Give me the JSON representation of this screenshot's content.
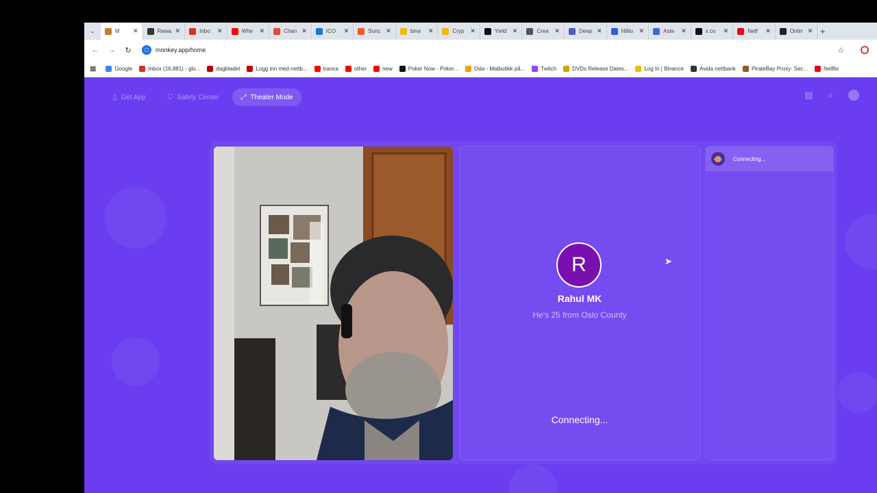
{
  "browser": {
    "tabs": [
      {
        "label": "M",
        "color": "#c97a2a",
        "active": true
      },
      {
        "label": "Rewa",
        "color": "#333333"
      },
      {
        "label": "Inbo",
        "color": "#d93025"
      },
      {
        "label": "Whe",
        "color": "#ff0000"
      },
      {
        "label": "Chan",
        "color": "#e8453c"
      },
      {
        "label": "ICO",
        "color": "#1a73e8"
      },
      {
        "label": "Sunc",
        "color": "#f05a28"
      },
      {
        "label": "bina",
        "color": "#f0b90b"
      },
      {
        "label": "Cryp",
        "color": "#f0b90b"
      },
      {
        "label": "Yield",
        "color": "#111111"
      },
      {
        "label": "Crea",
        "color": "#555555"
      },
      {
        "label": "Deep",
        "color": "#4a5cc9"
      },
      {
        "label": "Nillio",
        "color": "#2a62d9"
      },
      {
        "label": "Aste",
        "color": "#3a6ad9"
      },
      {
        "label": "x.co",
        "color": "#111111"
      },
      {
        "label": "Netf",
        "color": "#e50914"
      },
      {
        "label": "Onlin",
        "color": "#222222"
      }
    ],
    "url": "monkey.app/home",
    "bookmarks": [
      {
        "label": "Google",
        "color": "#4285f4"
      },
      {
        "label": "Inbox (16,881) - glu...",
        "color": "#d93025"
      },
      {
        "label": "dagbladet",
        "color": "#c00000"
      },
      {
        "label": "Logg inn med nettb...",
        "color": "#c00000"
      },
      {
        "label": "tranca",
        "color": "#ff0000"
      },
      {
        "label": "other",
        "color": "#ff0000"
      },
      {
        "label": "new",
        "color": "#ff0000"
      },
      {
        "label": "Poker Now - Poker...",
        "color": "#111111"
      },
      {
        "label": "Oda - Matbutikk på...",
        "color": "#f0a000"
      },
      {
        "label": "Twitch",
        "color": "#9146ff"
      },
      {
        "label": "DVDs Release Dates...",
        "color": "#d4a000"
      },
      {
        "label": "Log In | Binance",
        "color": "#f0b90b"
      },
      {
        "label": "Avida nettbank",
        "color": "#333333"
      },
      {
        "label": "PirateBay Proxy: Sec...",
        "color": "#8a5a2a"
      },
      {
        "label": "Netflix",
        "color": "#e50914"
      }
    ]
  },
  "nav": {
    "get_app": "Get App",
    "safety_center": "Safety Center",
    "theater_mode": "Theater Mode"
  },
  "remote_user": {
    "initial": "R",
    "name": "Rahul MK",
    "description": "He's 25 from Oslo County",
    "status": "Connecting..."
  },
  "chat": {
    "status": "Connecting..."
  }
}
